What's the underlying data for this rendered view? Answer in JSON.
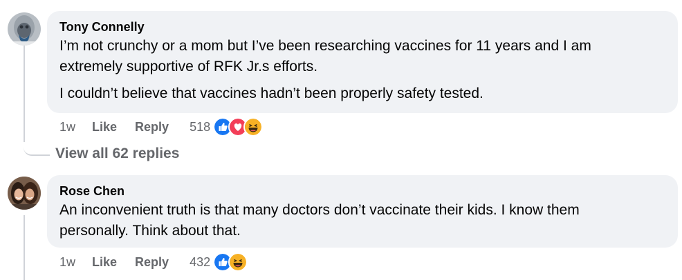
{
  "comments": [
    {
      "author": "Tony Connelly",
      "paragraphs": [
        "I’m not crunchy or a mom but I’ve been researching vaccines for 11 years and I am",
        "extremely supportive of RFK Jr.s efforts.",
        "I couldn’t believe that vaccines hadn’t been properly safety tested."
      ],
      "time": "1w",
      "like_label": "Like",
      "reply_label": "Reply",
      "reaction_count": "518",
      "reactions": [
        "like-icon",
        "love-icon",
        "haha-icon"
      ],
      "view_replies": "View all 62 replies"
    },
    {
      "author": "Rose Chen",
      "paragraphs": [
        "An inconvenient truth is that many doctors don’t vaccinate their kids. I know them",
        "personally. Think about that."
      ],
      "time": "1w",
      "like_label": "Like",
      "reply_label": "Reply",
      "reaction_count": "432",
      "reactions": [
        "like-icon",
        "haha-icon"
      ]
    }
  ],
  "colors": {
    "bubble": "#f0f2f5",
    "meta_text": "#65676b",
    "like_blue": "#1877f2",
    "love_red": "#f33e58",
    "haha_yellow": "#f7b125"
  }
}
